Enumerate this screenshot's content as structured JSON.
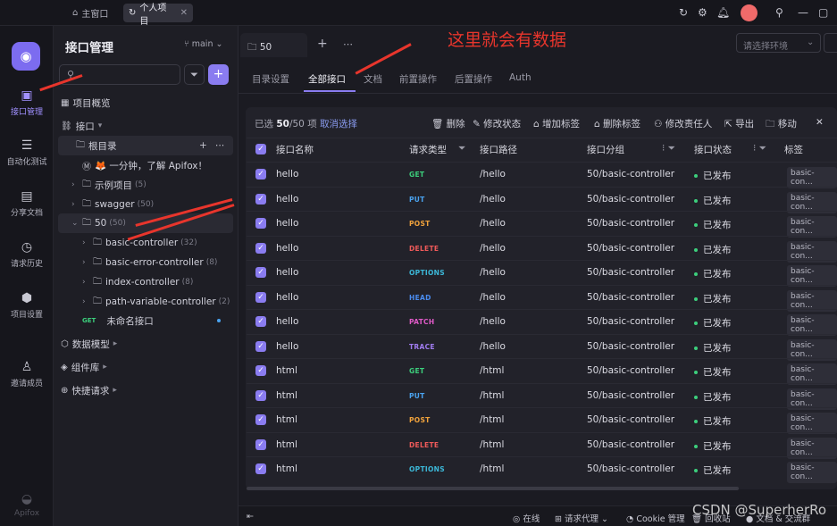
{
  "titlebar": {
    "tab_main": "主窗口",
    "tab_project": "个人项目"
  },
  "rail": {
    "items": [
      {
        "label": "接口管理",
        "icon": "api-icon"
      },
      {
        "label": "自动化测试",
        "icon": "test-icon"
      },
      {
        "label": "分享文档",
        "icon": "book-icon"
      },
      {
        "label": "请求历史",
        "icon": "history-icon"
      },
      {
        "label": "项目设置",
        "icon": "settings-icon"
      },
      {
        "label": "邀请成员",
        "icon": "invite-icon"
      }
    ],
    "brand": "Apifox",
    "accent": "#7c6cf0"
  },
  "sidebar": {
    "title": "接口管理",
    "branch": "main",
    "items": [
      {
        "label": "项目概览"
      },
      {
        "label": "接口"
      },
      {
        "label": "根目录"
      },
      {
        "label": "🦊 一分钟，了解 Apifox！"
      },
      {
        "label": "示例项目",
        "count": "(5)"
      },
      {
        "label": "swagger",
        "count": "(50)"
      },
      {
        "label": "50",
        "count": "(50)"
      },
      {
        "label": "basic-controller",
        "count": "(32)"
      },
      {
        "label": "basic-error-controller",
        "count": "(8)"
      },
      {
        "label": "index-controller",
        "count": "(8)"
      },
      {
        "label": "path-variable-controller",
        "count": "(2)"
      },
      {
        "label": "未命名接口",
        "method": "GET"
      },
      {
        "label": "数据模型"
      },
      {
        "label": "组件库"
      },
      {
        "label": "快捷请求"
      }
    ]
  },
  "main": {
    "tab_label": "50",
    "env_placeholder": "请选择环境",
    "annotation": "这里就会有数据",
    "subtabs": [
      "目录设置",
      "全部接口",
      "文档",
      "前置操作",
      "后置操作",
      "Auth"
    ],
    "selection": {
      "prefix": "已选",
      "selected": "50",
      "total": "/50 项",
      "cancel": "取消选择"
    },
    "actions": [
      "删除",
      "修改状态",
      "增加标签",
      "删除标签",
      "修改责任人",
      "导出",
      "移动"
    ],
    "columns": [
      "接口名称",
      "请求类型",
      "接口路径",
      "接口分组",
      "接口状态",
      "标签"
    ],
    "rows": [
      {
        "name": "hello",
        "method": "GET",
        "path": "/hello",
        "group": "50/basic-controller",
        "status": "已发布",
        "tag": "basic-con..."
      },
      {
        "name": "hello",
        "method": "PUT",
        "path": "/hello",
        "group": "50/basic-controller",
        "status": "已发布",
        "tag": "basic-con..."
      },
      {
        "name": "hello",
        "method": "POST",
        "path": "/hello",
        "group": "50/basic-controller",
        "status": "已发布",
        "tag": "basic-con..."
      },
      {
        "name": "hello",
        "method": "DELETE",
        "path": "/hello",
        "group": "50/basic-controller",
        "status": "已发布",
        "tag": "basic-con..."
      },
      {
        "name": "hello",
        "method": "OPTIONS",
        "path": "/hello",
        "group": "50/basic-controller",
        "status": "已发布",
        "tag": "basic-con..."
      },
      {
        "name": "hello",
        "method": "HEAD",
        "path": "/hello",
        "group": "50/basic-controller",
        "status": "已发布",
        "tag": "basic-con..."
      },
      {
        "name": "hello",
        "method": "PATCH",
        "path": "/hello",
        "group": "50/basic-controller",
        "status": "已发布",
        "tag": "basic-con..."
      },
      {
        "name": "hello",
        "method": "TRACE",
        "path": "/hello",
        "group": "50/basic-controller",
        "status": "已发布",
        "tag": "basic-con..."
      },
      {
        "name": "html",
        "method": "GET",
        "path": "/html",
        "group": "50/basic-controller",
        "status": "已发布",
        "tag": "basic-con..."
      },
      {
        "name": "html",
        "method": "PUT",
        "path": "/html",
        "group": "50/basic-controller",
        "status": "已发布",
        "tag": "basic-con..."
      },
      {
        "name": "html",
        "method": "POST",
        "path": "/html",
        "group": "50/basic-controller",
        "status": "已发布",
        "tag": "basic-con..."
      },
      {
        "name": "html",
        "method": "DELETE",
        "path": "/html",
        "group": "50/basic-controller",
        "status": "已发布",
        "tag": "basic-con..."
      },
      {
        "name": "html",
        "method": "OPTIONS",
        "path": "/html",
        "group": "50/basic-controller",
        "status": "已发布",
        "tag": "basic-con..."
      }
    ],
    "method_colors": {
      "GET": "#3ccf7c",
      "PUT": "#4aa3f0",
      "POST": "#f0a23c",
      "DELETE": "#f05a5a",
      "OPTIONS": "#3cb8d8",
      "HEAD": "#4a8cf0",
      "PATCH": "#e05ac8",
      "TRACE": "#a07cf0"
    }
  },
  "statusbar": {
    "online": "在线",
    "proxy": "请求代理",
    "cookie": "Cookie 管理",
    "recycle": "回收站",
    "docs": "文档 & 交流群",
    "watermark": "CSDN @SuperherRo"
  }
}
